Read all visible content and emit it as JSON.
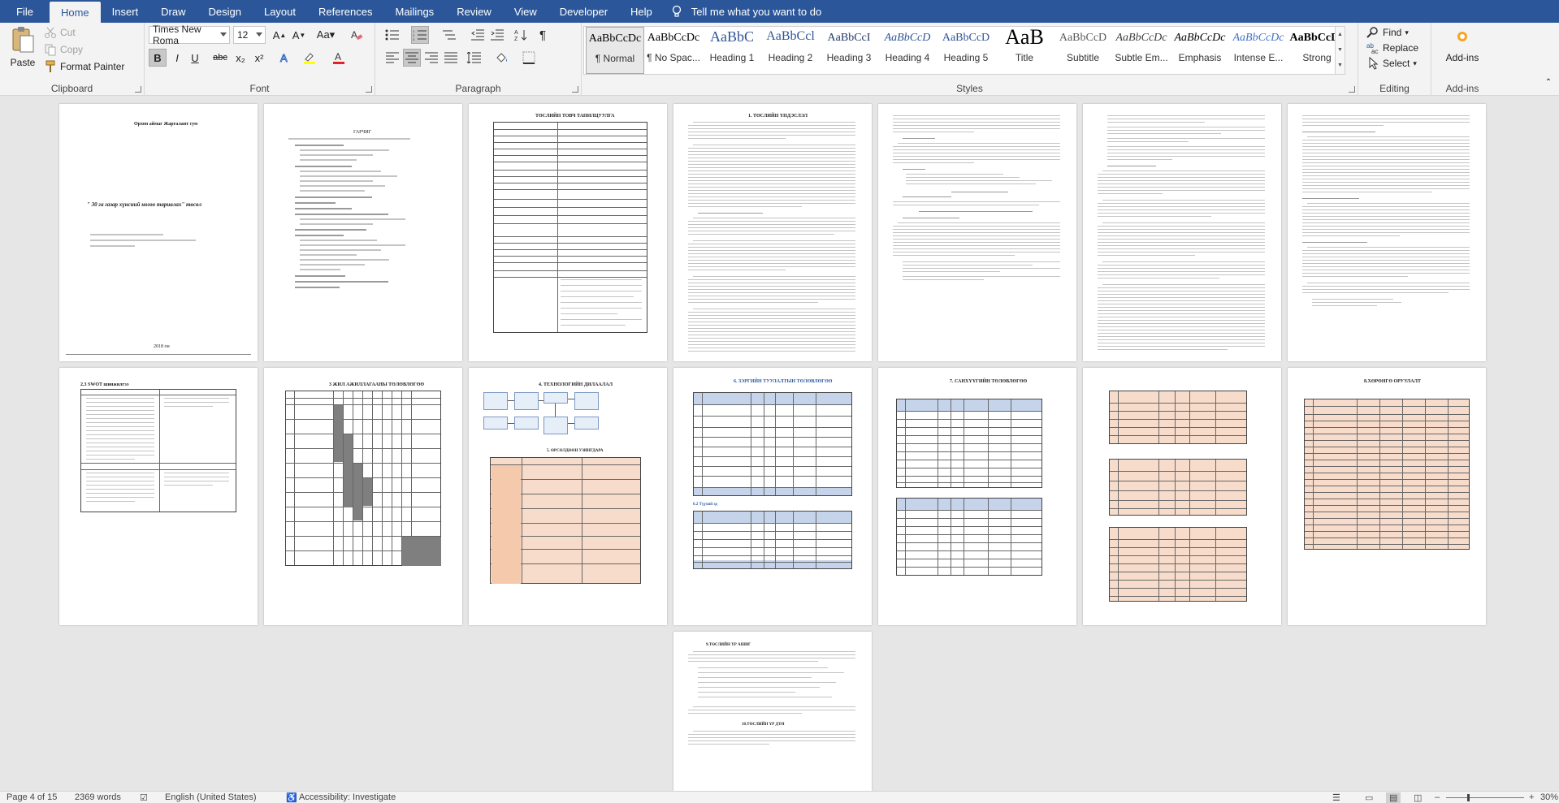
{
  "tabs": [
    "File",
    "Home",
    "Insert",
    "Draw",
    "Design",
    "Layout",
    "References",
    "Mailings",
    "Review",
    "View",
    "Developer",
    "Help"
  ],
  "tell_me": "Tell me what you want to do",
  "clipboard": {
    "paste": "Paste",
    "cut": "Cut",
    "copy": "Copy",
    "format_painter": "Format Painter",
    "label": "Clipboard"
  },
  "font": {
    "name": "Times New Roma",
    "size": "12",
    "label": "Font",
    "bold": "B",
    "italic": "I",
    "underline": "U",
    "strike": "abc",
    "sub": "x₂",
    "sup": "x²"
  },
  "paragraph": {
    "label": "Paragraph"
  },
  "styles": {
    "label": "Styles",
    "items": [
      {
        "preview": "AaBbCcDc",
        "name": "¶ Normal"
      },
      {
        "preview": "AaBbCcDc",
        "name": "¶ No Spac..."
      },
      {
        "preview": "AaBbC",
        "name": "Heading 1"
      },
      {
        "preview": "AaBbCcl",
        "name": "Heading 2"
      },
      {
        "preview": "AaBbCcI",
        "name": "Heading 3"
      },
      {
        "preview": "AaBbCcD",
        "name": "Heading 4"
      },
      {
        "preview": "AaBbCcD",
        "name": "Heading 5"
      },
      {
        "preview": "AaB",
        "name": "Title"
      },
      {
        "preview": "AaBbCcD",
        "name": "Subtitle"
      },
      {
        "preview": "AaBbCcDc",
        "name": "Subtle Em..."
      },
      {
        "preview": "AaBbCcDc",
        "name": "Emphasis"
      },
      {
        "preview": "AaBbCcDc",
        "name": "Intense E..."
      },
      {
        "preview": "AaBbCcDc",
        "name": "Strong"
      }
    ]
  },
  "editing": {
    "find": "Find",
    "replace": "Replace",
    "select": "Select",
    "label": "Editing"
  },
  "addins": {
    "label": "Add-ins",
    "button": "Add-ins"
  },
  "pages": {
    "p1_title": "Орхон аймаг Жаргалант сум",
    "p1_subject": "\" 30 га газар хүнсний ногоо тариалах\" төсөл",
    "p1_year": "2018 он",
    "p2_title": "ГАРЧИГ",
    "p3_title": "ТӨСЛИЙН ТОВЧ ТАНИЛЦУУЛГА",
    "p4_title": "1. ТӨСЛИЙН ҮНДЭСЛЭЛ",
    "p8_title": "2.3 SWOT шинжилгээ",
    "p9_title": "3 ЖИЛ АЖИЛЛАГААНЫ ТӨЛӨВЛӨГӨӨ",
    "p10_title": "4. ТЕХНОЛОГИЙН ДИЛААЛАЛ",
    "p11_title": "6. ЗЭРГИЙН ТУУЛАЛТЫН ТӨЛӨВЛӨГӨӨ",
    "p12_title": "7. САНХҮҮГИЙН ТӨЛӨВЛӨГӨӨ",
    "p14_title": "8.ХӨРӨНГӨ ОРУУЛАЛТ",
    "p15_title": "9.ТӨСЛИЙН ҮР АШИГ",
    "p15_title2": "10.ТӨСЛИЙН ҮР ДҮН"
  },
  "status": {
    "page": "Page 4 of 15",
    "words": "2369 words",
    "language": "English (United States)",
    "accessibility": "Accessibility: Investigate",
    "zoom": "30%"
  },
  "colors": {
    "accent": "#2b579a",
    "ribbon_bg": "#f3f3f3",
    "table_fill": "#f8dccb",
    "table_header": "#c5d4ea",
    "gantt_fill": "#7f7f7f"
  }
}
